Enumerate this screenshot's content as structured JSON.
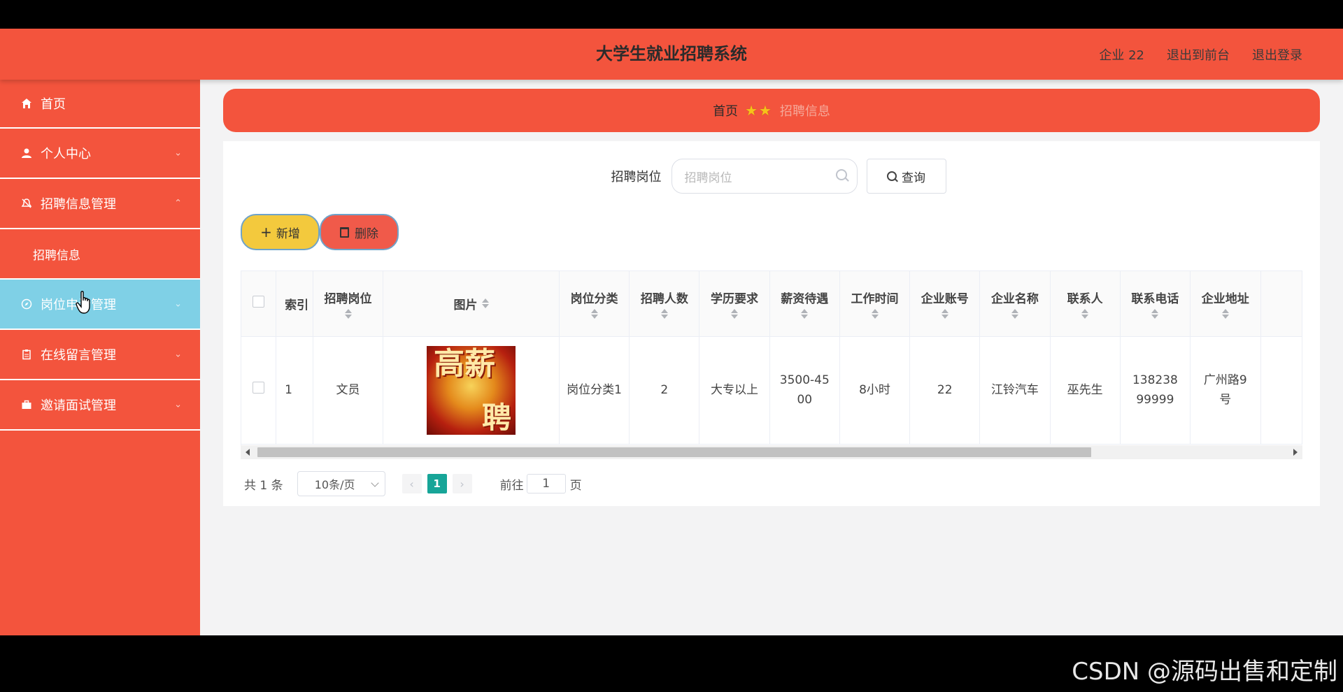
{
  "header": {
    "title": "大学生就业招聘系统",
    "user_label": "企业 22",
    "to_front_label": "退出到前台",
    "logout_label": "退出登录"
  },
  "sidebar": {
    "items": [
      {
        "label": "首页",
        "icon": "home-icon"
      },
      {
        "label": "个人中心",
        "icon": "user-icon"
      },
      {
        "label": "招聘信息管理",
        "icon": "bell-icon"
      },
      {
        "label": "岗位申请管理",
        "icon": "compass-icon"
      },
      {
        "label": "在线留言管理",
        "icon": "clipboard-icon"
      },
      {
        "label": "邀请面试管理",
        "icon": "briefcase-icon"
      }
    ],
    "submenu": {
      "label": "招聘信息"
    }
  },
  "breadcrumb": {
    "home": "首页",
    "separator": "★★",
    "current": "招聘信息"
  },
  "search": {
    "label": "招聘岗位",
    "placeholder": "招聘岗位",
    "button_label": "查询"
  },
  "actions": {
    "add_label": "新增",
    "delete_label": "删除"
  },
  "table": {
    "columns": [
      "索引",
      "招聘岗位",
      "图片",
      "岗位分类",
      "招聘人数",
      "学历要求",
      "薪资待遇",
      "工作时间",
      "企业账号",
      "企业名称",
      "联系人",
      "联系电话",
      "企业地址"
    ],
    "rows": [
      {
        "index": "1",
        "position": "文员",
        "image_text": "高薪 聘",
        "category": "岗位分类1",
        "count": "2",
        "education": "大专以上",
        "salary": "3500-4500",
        "hours": "8小时",
        "account": "22",
        "company": "江铃汽车",
        "contact": "巫先生",
        "phone": "13823899999",
        "address": "广州路9号"
      }
    ]
  },
  "pagination": {
    "total": "共 1 条",
    "page_size": "10条/页",
    "current_page": "1",
    "goto_label": "前往",
    "goto_value": "1",
    "page_unit": "页"
  },
  "watermark": "CSDN @源码出售和定制",
  "colors": {
    "primary": "#f3543d",
    "active_menu": "#7fd0e6",
    "add_button": "#f3c93d",
    "delete_button": "#f05a4a",
    "page_active": "#17a598"
  }
}
